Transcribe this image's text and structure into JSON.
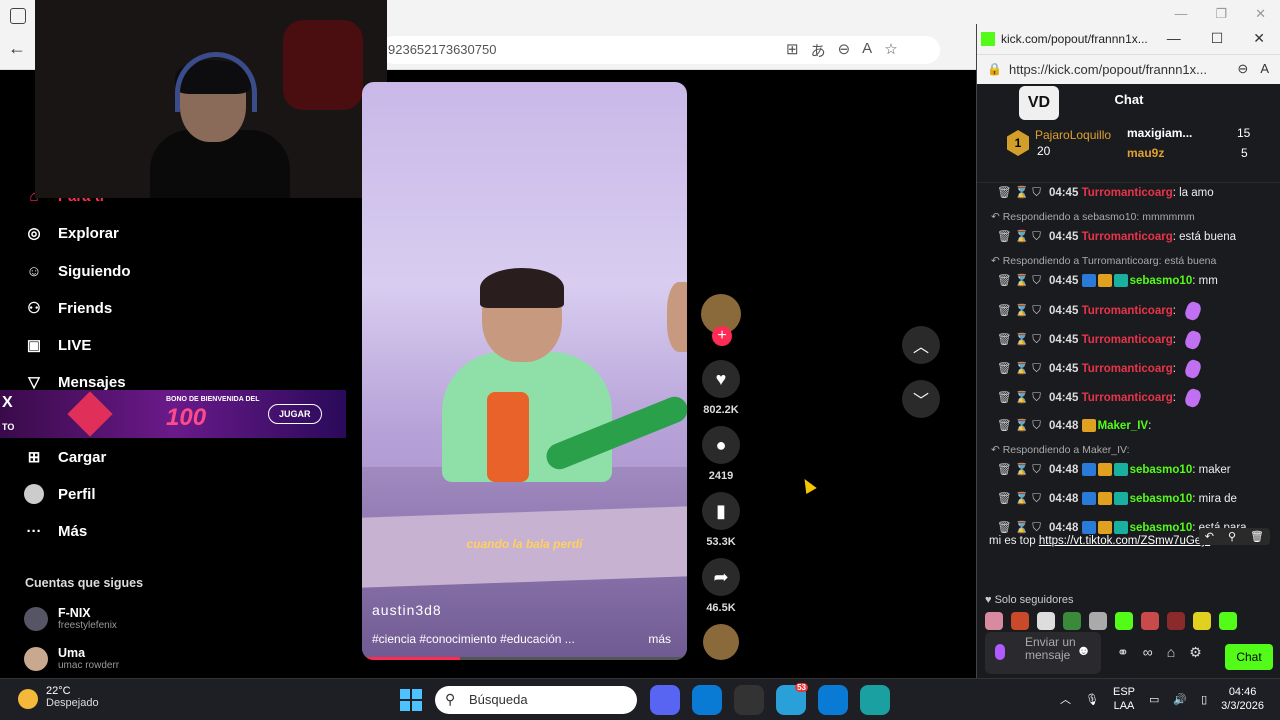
{
  "browser": {
    "address_text": "923652173630750"
  },
  "sidebar": {
    "items": [
      {
        "label": "Para ti",
        "icon": "home-icon"
      },
      {
        "label": "Explorar",
        "icon": "compass-icon"
      },
      {
        "label": "Siguiendo",
        "icon": "following-icon"
      },
      {
        "label": "Friends",
        "icon": "friends-icon"
      },
      {
        "label": "LIVE",
        "icon": "live-icon"
      },
      {
        "label": "Mensajes",
        "icon": "messages-icon"
      },
      {
        "label": "Cargar",
        "icon": "upload-icon"
      },
      {
        "label": "Perfil",
        "icon": "profile-icon"
      },
      {
        "label": "Más",
        "icon": "more-icon"
      }
    ],
    "following_title": "Cuentas que sigues",
    "following": [
      {
        "name": "F-NIX",
        "handle": "freestylefenix"
      },
      {
        "name": "Uma",
        "handle": "umac rowderr"
      }
    ]
  },
  "ad": {
    "line1": "BONO DE BIENVENIDA DEL",
    "line2": "100",
    "button": "JUGAR",
    "x": "X",
    "to": "TO"
  },
  "video": {
    "caption": "cuando la bala perdí",
    "author": "austin3d8",
    "tags": "#ciencia #conocimiento #educación ...",
    "more": "más",
    "progress": 0.3
  },
  "actions": {
    "likes": "802.2K",
    "comments": "2419",
    "saves": "53.3K",
    "shares": "46.5K"
  },
  "kick": {
    "window_title": "kick.com/popout/frannn1x...",
    "url": "https://kick.com/popout/frannn1x...",
    "chat_title": "Chat",
    "logo": "VD",
    "leaderboard": {
      "rank": "1",
      "user1": "PajaroLoquillo",
      "points1": "20",
      "user2": "maxigiam...",
      "points2": "15",
      "user3": "mau9z",
      "points3": "5"
    },
    "messages": [
      {
        "kind": "msg",
        "time": "04:45",
        "user": "Turromanticoarg",
        "color": "red",
        "text": ": la amo"
      },
      {
        "kind": "reply",
        "text": "Respondiendo a sebasmo10: mmmmmm"
      },
      {
        "kind": "msg",
        "time": "04:45",
        "user": "Turromanticoarg",
        "color": "red",
        "text": ": está buena"
      },
      {
        "kind": "reply",
        "text": "Respondiendo a Turromanticoarg: está buena"
      },
      {
        "kind": "msg",
        "time": "04:45",
        "user": "sebasmo10",
        "color": "green",
        "text": ": mm",
        "badges": true
      },
      {
        "kind": "msg",
        "time": "04:45",
        "user": "Turromanticoarg",
        "color": "red",
        "text": ":",
        "sticker": true
      },
      {
        "kind": "msg",
        "time": "04:45",
        "user": "Turromanticoarg",
        "color": "red",
        "text": ":",
        "sticker": true
      },
      {
        "kind": "msg",
        "time": "04:45",
        "user": "Turromanticoarg",
        "color": "red",
        "text": ":",
        "sticker": true
      },
      {
        "kind": "msg",
        "time": "04:45",
        "user": "Turromanticoarg",
        "color": "red",
        "text": ":",
        "sticker": true
      },
      {
        "kind": "msg",
        "time": "04:48",
        "user": "Maker_IV",
        "color": "green",
        "text": ":",
        "crown": true
      },
      {
        "kind": "reply",
        "text": "Respondiendo a Maker_IV:"
      },
      {
        "kind": "msg",
        "time": "04:48",
        "user": "sebasmo10",
        "color": "green",
        "text": ": maker",
        "badges": true
      },
      {
        "kind": "msg",
        "time": "04:48",
        "user": "sebasmo10",
        "color": "green",
        "text": ": mira de",
        "badges": true
      },
      {
        "kind": "msg",
        "time": "04:48",
        "user": "sebasmo10",
        "color": "green",
        "text": ": está para",
        "badges": true
      }
    ],
    "last_line_text": "mi es top",
    "last_line_link": "https://vt.tiktok.com/ZSmw7uGey/",
    "followers_only": "Solo seguidores",
    "input_placeholder": "Enviar un mensaje",
    "send": "Chat"
  },
  "taskbar": {
    "temp": "22°C",
    "weather": "Despejado",
    "search": "Búsqueda",
    "lang1": "ESP",
    "lang2": "LAA",
    "time": "04:46",
    "date": "3/3/2026",
    "badge": "53"
  }
}
